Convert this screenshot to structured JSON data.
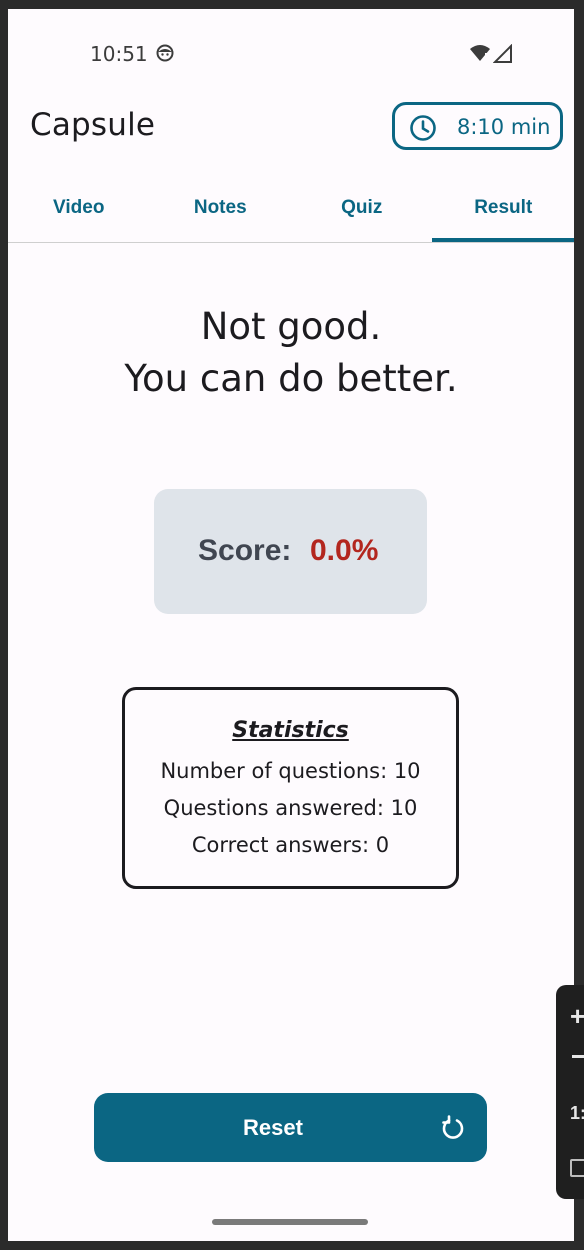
{
  "status_bar": {
    "time": "10:51",
    "face_icon": "android-face-icon",
    "wifi_icon": "wifi-icon",
    "signal_icon": "signal-icon"
  },
  "header": {
    "title": "Capsule",
    "timer_icon": "clock-icon",
    "timer_text": "8:10 min"
  },
  "tabs": [
    {
      "label": "Video",
      "active": false
    },
    {
      "label": "Notes",
      "active": false
    },
    {
      "label": "Quiz",
      "active": false
    },
    {
      "label": "Result",
      "active": true
    }
  ],
  "result": {
    "headline_line1": "Not good.",
    "headline_line2": "You can do better.",
    "score_label": "Score:",
    "score_value": "0.0%"
  },
  "statistics": {
    "title": "Statistics",
    "lines": [
      "Number of questions: 10",
      "Questions answered: 10",
      "Correct answers: 0"
    ]
  },
  "reset": {
    "label": "Reset",
    "icon": "refresh-icon"
  },
  "side_panel": {
    "plus_label": "+",
    "text_fragment": "1:"
  },
  "colors": {
    "accent": "#0b6683",
    "score_bad": "#b3261e",
    "score_card_bg": "#dfe4ea",
    "background": "#fefbfe"
  }
}
